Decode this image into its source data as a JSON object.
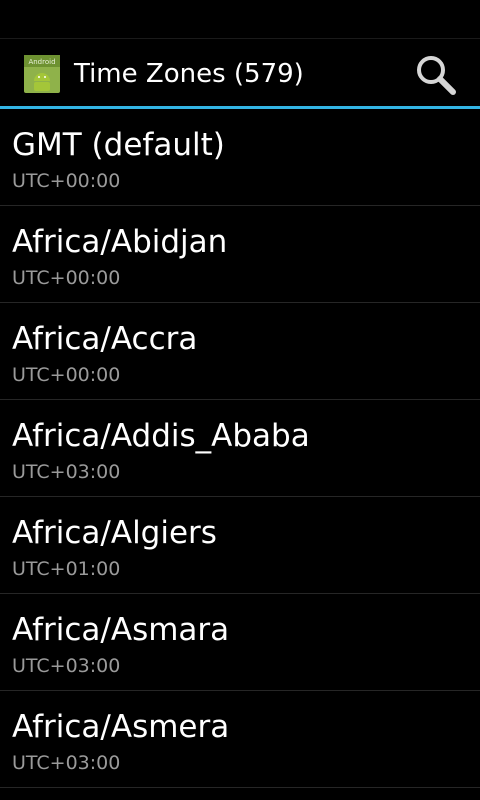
{
  "action_bar": {
    "app_icon": "android-app-icon",
    "app_icon_text": "Android",
    "title": "Time Zones (579)",
    "search_icon": "search-icon",
    "accent_color": "#33b5e5"
  },
  "timezones": [
    {
      "name": "GMT (default)",
      "offset": "UTC+00:00"
    },
    {
      "name": "Africa/Abidjan",
      "offset": "UTC+00:00"
    },
    {
      "name": "Africa/Accra",
      "offset": "UTC+00:00"
    },
    {
      "name": "Africa/Addis_Ababa",
      "offset": "UTC+03:00"
    },
    {
      "name": "Africa/Algiers",
      "offset": "UTC+01:00"
    },
    {
      "name": "Africa/Asmara",
      "offset": "UTC+03:00"
    },
    {
      "name": "Africa/Asmera",
      "offset": "UTC+03:00"
    }
  ]
}
